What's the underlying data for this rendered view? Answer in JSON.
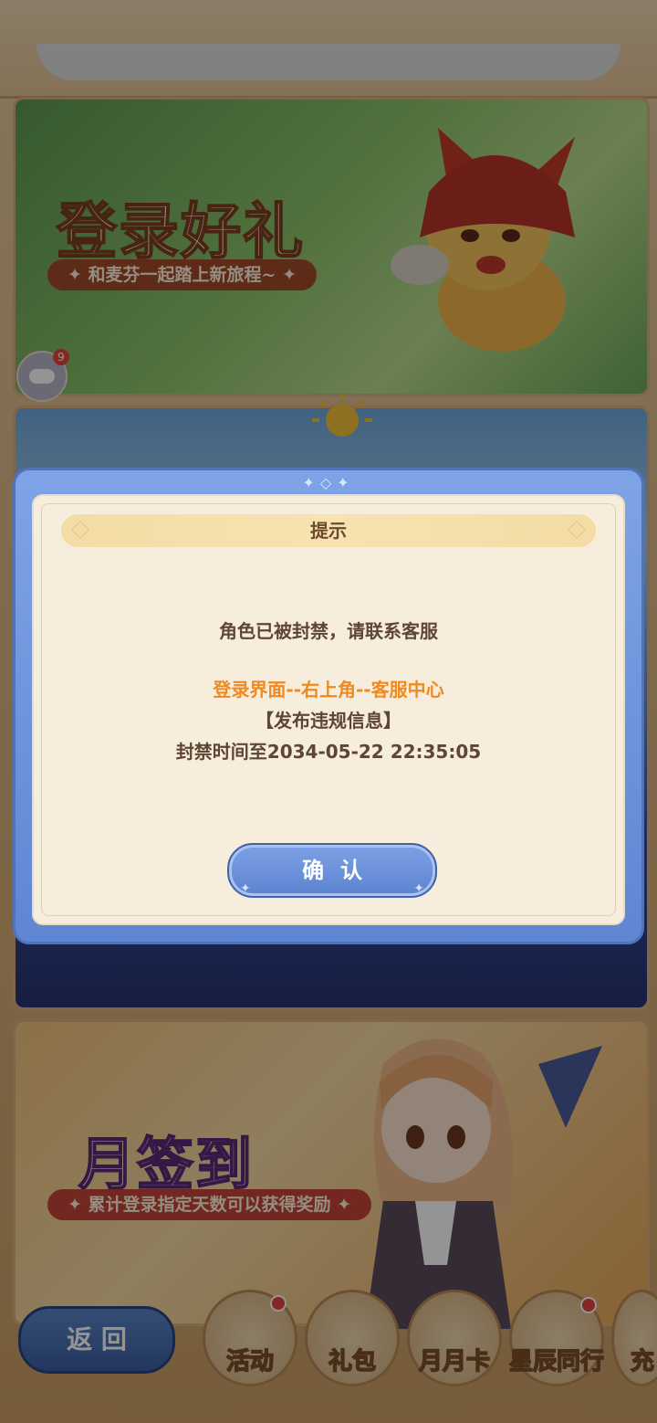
{
  "banners": [
    {
      "title": "登录好礼",
      "subtitle": "✦ 和麦芬一起踏上新旅程~ ✦"
    },
    {
      "title": "",
      "subtitle": ""
    },
    {
      "title": "月签到",
      "subtitle": "✦ 累计登录指定天数可以获得奖励 ✦"
    }
  ],
  "chat": {
    "badge_count": "9"
  },
  "bottom_nav": {
    "back_label": "返 回",
    "items": [
      {
        "label": "活动",
        "has_dot": true
      },
      {
        "label": "礼包",
        "has_dot": false
      },
      {
        "label": "月月卡",
        "has_dot": false
      },
      {
        "label": "星辰同行",
        "has_dot": true
      },
      {
        "label": "充",
        "has_dot": false
      }
    ]
  },
  "dialog": {
    "title": "提示",
    "message_line1": "角色已被封禁，请联系客服",
    "message_line2": "登录界面--右上角--客服中心",
    "message_line3": "【发布违规信息】",
    "message_line4": "封禁时间至2034-05-22  22:35:05",
    "confirm_label": "确认"
  },
  "colors": {
    "dialog_frame": "#6f95dc",
    "dialog_body": "#f6eddc",
    "highlight_text": "#f08a20",
    "body_text": "#5f4634"
  }
}
